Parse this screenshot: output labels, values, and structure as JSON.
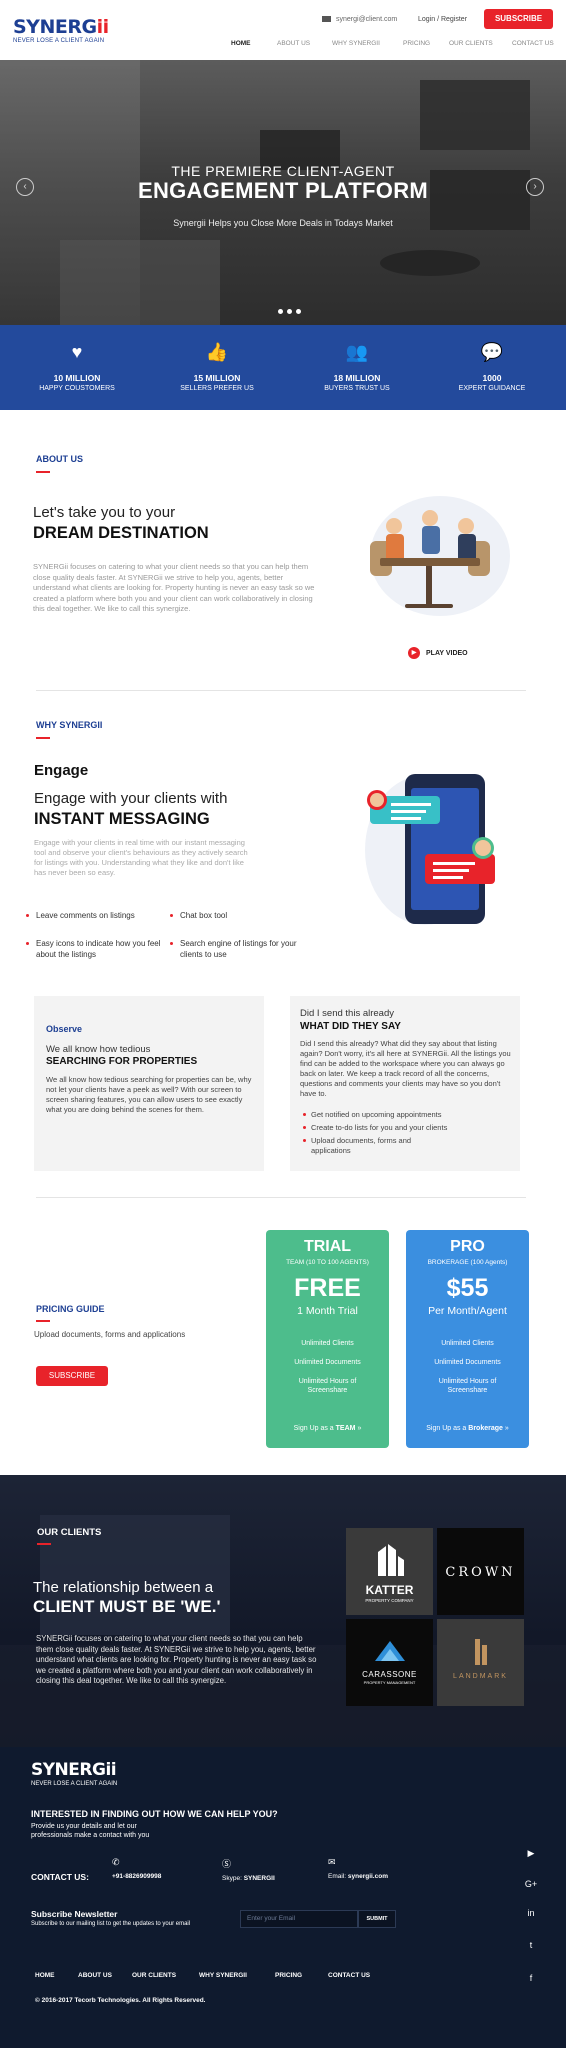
{
  "header": {
    "logo_main": "SYNERG",
    "logo_accent": "ii",
    "logo_tagline": "NEVER LOSE A CLIENT AGAIN",
    "email": "synergi@client.com",
    "login": "Login / Register",
    "subscribe": "SUBSCRIBE",
    "nav": [
      "HOME",
      "ABOUT US",
      "WHY SYNERGII",
      "PRICING",
      "OUR CLIENTS",
      "CONTACT US"
    ]
  },
  "hero": {
    "subtitle": "THE PREMIERE CLIENT-AGENT",
    "title": "ENGAGEMENT PLATFORM",
    "text": "Synergii Helps you Close More Deals in Todays Market",
    "prev": "‹",
    "next": "›"
  },
  "stats": [
    {
      "icon": "heart-icon",
      "glyph": "♥",
      "number": "10 MILLION",
      "label": "HAPPY COUSTOMERS"
    },
    {
      "icon": "thumbs-up-icon",
      "glyph": "👍",
      "number": "15 MILLION",
      "label": "SELLERS PREFER US"
    },
    {
      "icon": "users-icon",
      "glyph": "👥",
      "number": "18 MILLION",
      "label": "BUYERS TRUST US"
    },
    {
      "icon": "chat-icon",
      "glyph": "💬",
      "number": "1000",
      "label": "EXPERT GUIDANCE"
    }
  ],
  "about": {
    "label": "ABOUT US",
    "heading_light": "Let's take you to your",
    "heading_bold": "DREAM DESTINATION",
    "paragraph": "SYNERGii focuses on catering to what your client needs so that you can help them close quality deals faster. At SYNERGii we strive to help you, agents, better understand what clients are looking for. Property hunting is never an easy task so we created a platform where both you and your client can work collaboratively in closing this deal together. We like to call this synergize.",
    "play_video": "PLAY VIDEO"
  },
  "why": {
    "label": "WHY SYNERGII",
    "heading_top": "Engage",
    "heading_light": "Engage with your clients with",
    "heading_bold": "INSTANT MESSAGING",
    "paragraph": "Engage with your clients in real time with our instant messaging tool and observe your client's behaviours as they actively search for listings with you. Understanding what they like and don't like has never been so easy.",
    "features": [
      "Leave comments on listings",
      "Chat box tool",
      "Easy icons to indicate how you feel about the listings",
      "Search engine of listings for your clients to use"
    ]
  },
  "observe": {
    "label": "Observe",
    "heading_light": "We all know how tedious",
    "heading_bold": "SEARCHING FOR PROPERTIES",
    "paragraph": "We all know how tedious searching for properties can be, why not let your clients have a peek as well? With our screen to screen sharing features, you can allow users to see exactly what you are doing behind the scenes for them."
  },
  "said": {
    "heading_light": "Did I send this already",
    "heading_bold": "WHAT DID THEY SAY",
    "paragraph": "Did I send this already? What did they say about that listing again? Don't worry, it's all here at SYNERGii. All the listings you find can be added to the workspace where you can always go back on later. We keep a track record of all the concerns, questions and comments your clients may have so you don't have to.",
    "items": [
      "Get notified on upcoming appointments",
      "Create to-do lists for you and your clients",
      "Upload documents, forms and applications"
    ]
  },
  "pricing": {
    "label": "PRICING GUIDE",
    "text": "Upload documents, forms and applications",
    "button": "SUBSCRIBE",
    "plans": [
      {
        "name": "TRIAL",
        "sub": "TEAM (10 TO 100 AGENTS)",
        "price": "FREE",
        "per": "1 Month Trial",
        "features": [
          "Unlimited Clients",
          "Unlimited Documents",
          "Unlimited Hours of Screenshare"
        ],
        "signup_prefix": "Sign Up as a ",
        "signup_bold": "TEAM",
        "color": "#4dbd8c"
      },
      {
        "name": "PRO",
        "sub": "BROKERAGE (100 Agents)",
        "price": "$55",
        "per": "Per Month/Agent",
        "features": [
          "Unlimited Clients",
          "Unlimited Documents",
          "Unlimited Hours of Screenshare"
        ],
        "signup_prefix": "Sign Up as a ",
        "signup_bold": "Brokerage",
        "color": "#3b8fe0"
      }
    ]
  },
  "clients": {
    "label": "OUR CLIENTS",
    "heading_light": "The relationship between a",
    "heading_bold": "CLIENT MUST BE 'WE.'",
    "paragraph": "SYNERGii focuses on catering to what your client needs so that you can help them close quality deals faster. At SYNERGii we strive to help you, agents, better understand what clients are looking for. Property hunting is never an easy task so we created a platform where both you and your client can work collaboratively in closing this deal together. We like to call this synergize.",
    "logos": [
      {
        "name": "KATTER",
        "sub": "PROPERTY COMPANY"
      },
      {
        "name": "CROWN",
        "sub": ""
      },
      {
        "name": "CARASSONE",
        "sub": "PROPERTY MANAGEMENT"
      },
      {
        "name": "LANDMARK",
        "sub": ""
      }
    ]
  },
  "footer": {
    "logo": "SYNERGii",
    "tagline": "NEVER LOSE A CLIENT AGAIN",
    "heading": "INTERESTED IN FINDING OUT HOW WE CAN HELP YOU?",
    "text": "Provide us your details and let our professionals make a contact with you",
    "contact_label": "CONTACT US:",
    "phone": "+91-8826909998",
    "skype_prefix": "Skype: ",
    "skype": "SYNERGII",
    "email_prefix": "Email: ",
    "email": "synergii.com",
    "newsletter_title": "Subscribe Newsletter",
    "newsletter_text": "Subscribe to our mailing list to get the updates to your email",
    "input_placeholder": "Enter your Email",
    "submit": "SUBMIT",
    "nav": [
      "HOME",
      "ABOUT US",
      "OUR CLIENTS",
      "WHY SYNERGII",
      "PRICING",
      "CONTACT US"
    ],
    "copyright": "© 2016-2017 Tecorb Technologies. All Rights Reserved.",
    "social": [
      "youtube-icon",
      "google-plus-icon",
      "linkedin-icon",
      "twitter-icon",
      "facebook-icon"
    ]
  }
}
